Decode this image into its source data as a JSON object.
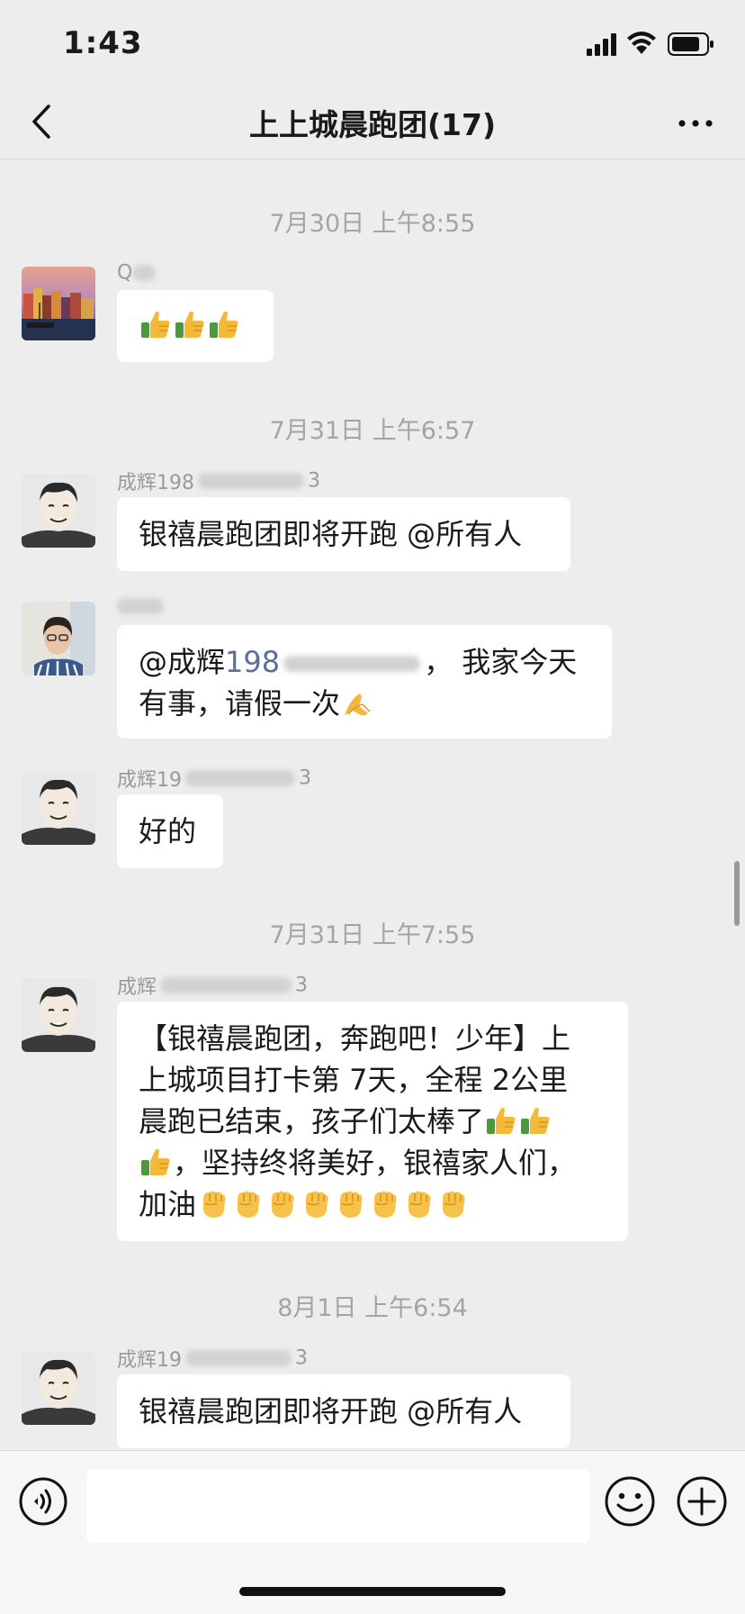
{
  "status_bar": {
    "time": "1:43"
  },
  "nav": {
    "title": "上上城晨跑团(17)"
  },
  "messages": [
    {
      "timestamp": "7月30日 上午8:55",
      "sender": "Q",
      "emoji_count": 3
    },
    {
      "timestamp": "7月31日 上午6:57",
      "sender_prefix": "成辉198",
      "sender_suffix": "3",
      "text": "银禧晨跑团即将开跑 @所有人"
    },
    {
      "sender": "",
      "text_mention": "@成辉",
      "text_number": "198",
      "text_after": "， 我家今天",
      "text_line2": "有事，请假一次"
    },
    {
      "sender_prefix": "成辉19",
      "sender_suffix": "3",
      "text": "好的"
    },
    {
      "timestamp": "7月31日 上午7:55",
      "sender_prefix": "成辉",
      "sender_suffix": "3",
      "line1": "【银禧晨跑团，奔跑吧！少年】上",
      "line2": "上城项目打卡第 7天，全程 2公里",
      "line3": "晨跑已结束，孩子们太棒了",
      "line4": "，坚持终将美好，银禧家人们，",
      "line5": "加油"
    },
    {
      "timestamp": "8月1日 上午6:54",
      "sender_prefix": "成辉19",
      "sender_suffix": "3",
      "text": "银禧晨跑团即将开跑 @所有人"
    }
  ],
  "icons": {
    "back": "chevron-left-icon",
    "more": "more-dots-icon",
    "voice": "voice-icon",
    "emoji": "smiley-icon",
    "plus": "plus-icon"
  },
  "colors": {
    "background": "#ededed",
    "bubble": "#ffffff",
    "mention_number": "#5a6f9a"
  }
}
